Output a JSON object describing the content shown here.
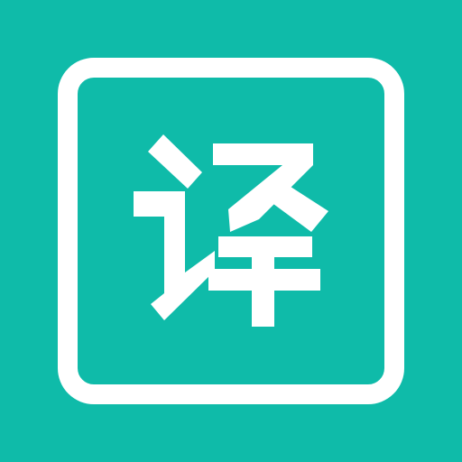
{
  "app_icon": {
    "glyph_text": "译",
    "glyph_meaning": "translate",
    "colors": {
      "background": "#0fbba9",
      "foreground": "#ffffff"
    }
  }
}
